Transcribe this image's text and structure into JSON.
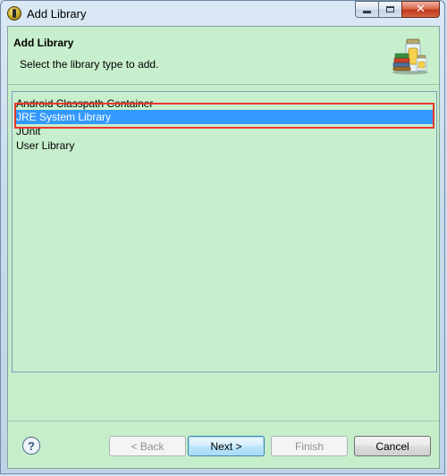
{
  "window": {
    "title": "Add Library",
    "controls": [
      "minimize-icon",
      "maximize-icon",
      "close-icon"
    ]
  },
  "header": {
    "title": "Add Library",
    "description": "Select the library type to add.",
    "icon": "library-jars-icon"
  },
  "library_types": [
    {
      "label": "Android Classpath Container",
      "selected": false
    },
    {
      "label": "JRE System Library",
      "selected": true
    },
    {
      "label": "JUnit",
      "selected": false
    },
    {
      "label": "User Library",
      "selected": false
    }
  ],
  "footer": {
    "help_icon": "help-icon",
    "back_label": "< Back",
    "next_label": "Next >",
    "finish_label": "Finish",
    "cancel_label": "Cancel"
  },
  "colors": {
    "selection": "#3399ff",
    "highlight_box": "#e8382f",
    "panel_background": "#c8efcd"
  }
}
